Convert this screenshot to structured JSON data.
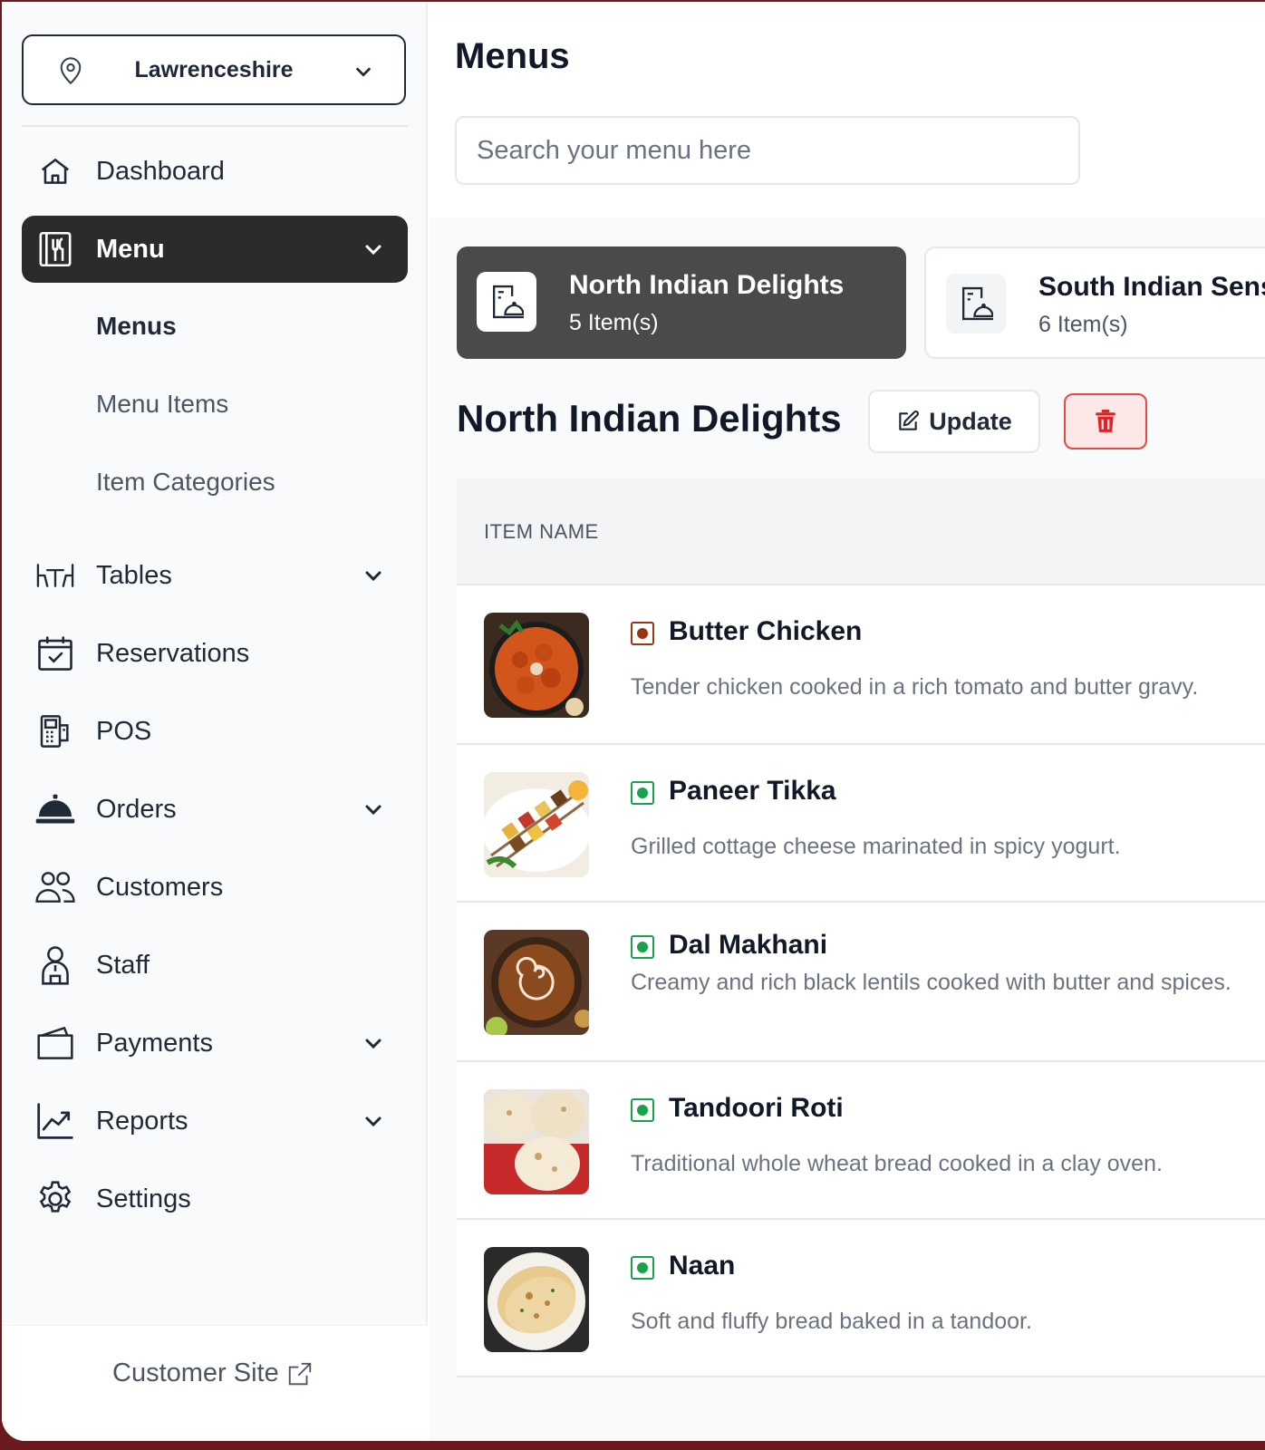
{
  "sidebar": {
    "location": "Lawrenceshire",
    "nav": [
      {
        "label": "Dashboard"
      },
      {
        "label": "Menu"
      },
      {
        "label": "Tables"
      },
      {
        "label": "Reservations"
      },
      {
        "label": "POS"
      },
      {
        "label": "Orders"
      },
      {
        "label": "Customers"
      },
      {
        "label": "Staff"
      },
      {
        "label": "Payments"
      },
      {
        "label": "Reports"
      },
      {
        "label": "Settings"
      }
    ],
    "menu_sub": [
      "Menus",
      "Menu Items",
      "Item Categories"
    ],
    "footer_link": "Customer Site"
  },
  "main": {
    "title": "Menus",
    "search_placeholder": "Search your menu here",
    "menus": [
      {
        "name": "North Indian Delights",
        "count": "5 Item(s)"
      },
      {
        "name": "South Indian Sensations",
        "count": "6 Item(s)"
      }
    ],
    "selected_menu_title": "North Indian Delights",
    "update_label": "Update",
    "table_header": "ITEM NAME",
    "items": [
      {
        "name": "Butter Chicken",
        "desc": "Tender chicken cooked in a rich tomato and butter gravy.",
        "diet": "non-veg"
      },
      {
        "name": "Paneer Tikka",
        "desc": "Grilled cottage cheese marinated in spicy yogurt.",
        "diet": "veg"
      },
      {
        "name": "Dal Makhani",
        "desc": "Creamy and rich black lentils cooked with butter and spices.",
        "diet": "veg"
      },
      {
        "name": "Tandoori Roti",
        "desc": "Traditional whole wheat bread cooked in a clay oven.",
        "diet": "veg"
      },
      {
        "name": "Naan",
        "desc": "Soft and fluffy bread baked in a tandoor.",
        "diet": "veg"
      }
    ]
  },
  "colors": {
    "active_nav": "#2b2b2b",
    "selected_card": "#4a4a4a",
    "veg": "#16a34a",
    "non_veg": "#9a3412",
    "danger": "#ef4444"
  }
}
